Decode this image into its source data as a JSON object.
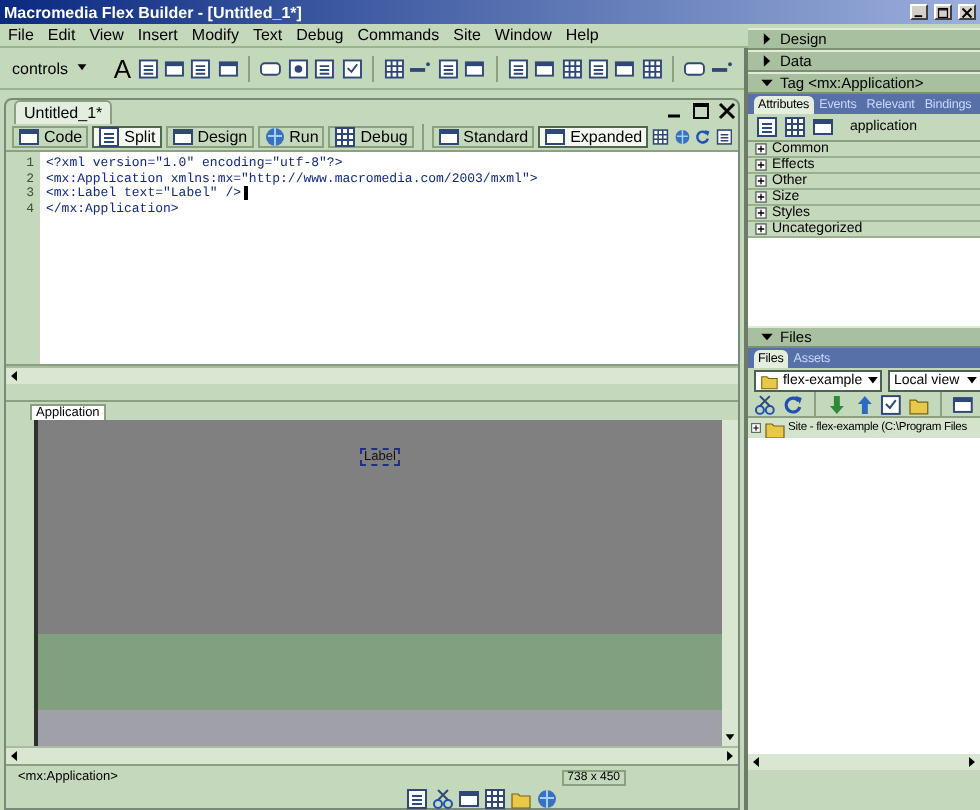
{
  "window": {
    "title": "Macromedia Flex Builder - [Untitled_1*]"
  },
  "menu": [
    "File",
    "Edit",
    "View",
    "Insert",
    "Modify",
    "Text",
    "Debug",
    "Commands",
    "Site",
    "Window",
    "Help"
  ],
  "toolbar": {
    "dropdown": "controls",
    "text_tool": "A"
  },
  "document": {
    "tab": "Untitled_1*",
    "view_buttons": [
      {
        "label": "Code",
        "selected": false
      },
      {
        "label": "Split",
        "selected": true
      },
      {
        "label": "Design",
        "selected": false
      },
      {
        "label": "Run",
        "selected": false
      },
      {
        "label": "Debug",
        "selected": false
      }
    ],
    "mode_buttons": [
      {
        "label": "Standard",
        "selected": false
      },
      {
        "label": "Expanded",
        "selected": true
      }
    ],
    "code_lines": [
      {
        "number": "1",
        "text": "<?xml version=\"1.0\" encoding=\"utf-8\"?>"
      },
      {
        "number": "2",
        "text": "<mx:Application xmlns:mx=\"http://www.macromedia.com/2003/mxml\">"
      },
      {
        "number": "3",
        "text": "<mx:Label text=\"Label\" />"
      },
      {
        "number": "4",
        "text": "</mx:Application>"
      }
    ],
    "design_tab": "Application",
    "label_component": "Label",
    "status_tag": "<mx:Application>",
    "size": "738 x 450"
  },
  "panels": [
    {
      "kind": "header",
      "title": "Design",
      "expanded": false
    },
    {
      "kind": "header",
      "title": "Data",
      "expanded": false
    },
    {
      "kind": "tag",
      "title": "Tag <mx:Application>",
      "expanded": true,
      "tabs": [
        {
          "label": "Attributes",
          "selected": true
        },
        {
          "label": "Events",
          "selected": false
        },
        {
          "label": "Relevant",
          "selected": false
        },
        {
          "label": "Bindings",
          "selected": false
        }
      ],
      "object": "application",
      "categories": [
        {
          "label": "Common",
          "expanded": false
        },
        {
          "label": "Effects",
          "expanded": false
        },
        {
          "label": "Other",
          "expanded": false
        },
        {
          "label": "Size",
          "expanded": false
        },
        {
          "label": "Styles",
          "expanded": false
        },
        {
          "label": "Uncategorized",
          "expanded": false
        }
      ]
    },
    {
      "kind": "files",
      "title": "Files",
      "expanded": true,
      "tabs": [
        {
          "label": "Files",
          "selected": true
        },
        {
          "label": "Assets",
          "selected": false
        }
      ],
      "site": "flex-example",
      "view": "Local view",
      "tree": [
        {
          "label": "Site - flex-example (C:\\Program Files",
          "expanded": false
        }
      ]
    }
  ]
}
